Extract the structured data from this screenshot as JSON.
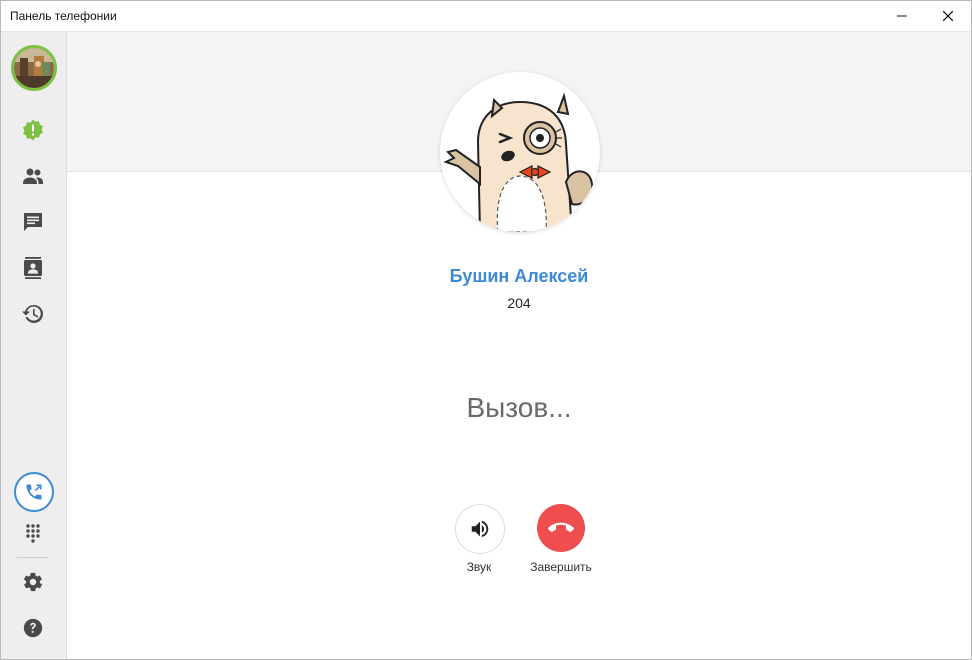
{
  "window": {
    "title": "Панель телефонии"
  },
  "sidebar": {
    "items": [
      {
        "name": "status",
        "icon": "alert-badge-icon"
      },
      {
        "name": "contacts",
        "icon": "people-icon"
      },
      {
        "name": "messages",
        "icon": "chat-icon"
      },
      {
        "name": "address-book",
        "icon": "contact-card-icon"
      },
      {
        "name": "history",
        "icon": "history-icon"
      }
    ],
    "bottom": [
      {
        "name": "active-call",
        "icon": "phone-outgoing-icon"
      },
      {
        "name": "dialpad",
        "icon": "dialpad-icon"
      },
      {
        "name": "settings",
        "icon": "gear-icon"
      },
      {
        "name": "help",
        "icon": "help-icon"
      }
    ]
  },
  "call": {
    "contact_name": "Бушин Алексей",
    "extension": "204",
    "status": "Вызов...",
    "sound_label": "Звук",
    "hangup_label": "Завершить"
  },
  "colors": {
    "accent": "#3c8ad8",
    "presence": "#7cc242",
    "hangup": "#ee4e4e",
    "icon": "#4a4a4a"
  }
}
